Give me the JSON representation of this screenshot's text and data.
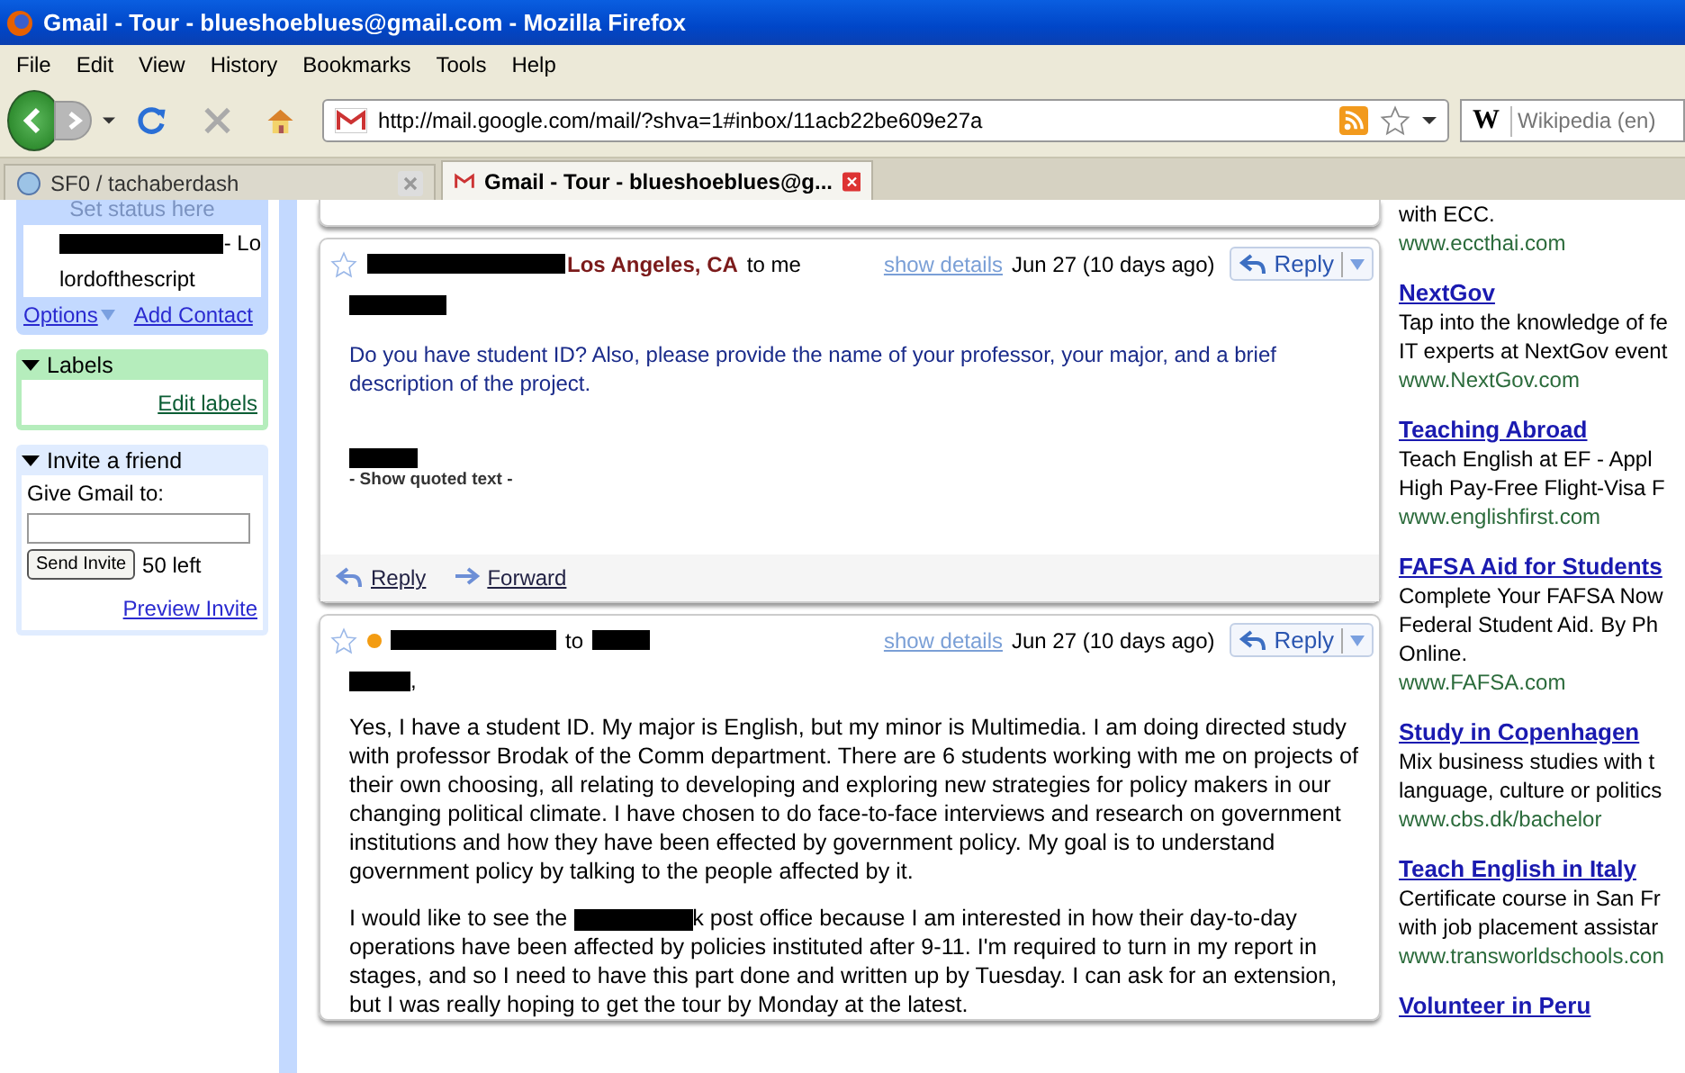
{
  "window": {
    "title": "Gmail - Tour - blueshoeblues@gmail.com - Mozilla Firefox"
  },
  "menu": [
    "File",
    "Edit",
    "View",
    "History",
    "Bookmarks",
    "Tools",
    "Help"
  ],
  "toolbar": {
    "url": "http://mail.google.com/mail/?shva=1#inbox/11acb22be609e27a",
    "search_engine": "W",
    "search_placeholder": "Wikipedia (en)"
  },
  "tabs": [
    {
      "label": "SF0 / tachaberdash",
      "selected": false
    },
    {
      "label": "Gmail - Tour - blueshoeblues@g...",
      "selected": true
    }
  ],
  "sidebar": {
    "status_placeholder": "Set status here",
    "contacts": [
      "- Lo",
      "lordofthescript"
    ],
    "options": "Options",
    "add_contact": "Add Contact",
    "labels": {
      "title": "Labels",
      "expanded": true,
      "edit": "Edit labels"
    },
    "invite": {
      "title": "Invite a friend",
      "expanded": true,
      "prompt": "Give Gmail to:",
      "button": "Send Invite",
      "count": "50 left",
      "preview": "Preview Invite"
    }
  },
  "messages": [
    {
      "sender": "Los Angeles, CA",
      "to": "to me",
      "online": false,
      "starred": false,
      "show_details": "show details",
      "date": "Jun 27 (10 days ago)",
      "reply": "Reply",
      "body": [
        "Do you have student ID? Also, please provide the name of your professor, your major, and a brief description of the project."
      ],
      "quoted": "- Show quoted text -",
      "actions": [
        "Reply",
        "Forward"
      ]
    },
    {
      "to": "to",
      "online": true,
      "starred": false,
      "show_details": "show details",
      "date": "Jun 27 (10 days ago)",
      "reply": "Reply",
      "greeting": ",",
      "body": [
        "Yes, I have a student ID. My major is English, but my minor is Multimedia. I am doing directed study with professor Brodak of the Comm department.  There are 6 students working with me on projects of their own choosing, all relating to developing and exploring new strategies for policy makers in our changing political climate. I have chosen to do face-to-face interviews and research on government institutions and how they have been effected by government policy. My goal is to understand government policy by talking to the people affected by it.",
        "I would like to see the ",
        "k post office because I am interested in how their day-to-day operations have been affected by policies instituted after 9-11. I'm required to turn in my report in stages, and so I need to have this part done and written up by Tuesday. I can ask for an extension, but I was really hoping to get the tour by Monday at the latest."
      ]
    }
  ],
  "ads": [
    {
      "lines": [
        "with ECC."
      ],
      "url": "www.eccthai.com"
    },
    {
      "title": "NextGov",
      "lines": [
        "Tap into the knowledge of fe",
        "IT experts at NextGov event"
      ],
      "url": "www.NextGov.com"
    },
    {
      "title": "Teaching Abroad",
      "lines": [
        "Teach English at EF - Appl",
        "High Pay-Free Flight-Visa F"
      ],
      "url": "www.englishfirst.com"
    },
    {
      "title": "FAFSA Aid for Students",
      "lines": [
        "Complete Your FAFSA Now",
        "Federal Student Aid. By Ph",
        "Online."
      ],
      "url": "www.FAFSA.com"
    },
    {
      "title": "Study in Copenhagen",
      "lines": [
        "Mix business studies with t",
        "language, culture or politics"
      ],
      "url": "www.cbs.dk/bachelor"
    },
    {
      "title": "Teach English in Italy",
      "lines": [
        "Certificate course in San Fr",
        "with job placement assistar"
      ],
      "url": "www.transworldschools.con"
    },
    {
      "title": "Volunteer in Peru"
    }
  ]
}
